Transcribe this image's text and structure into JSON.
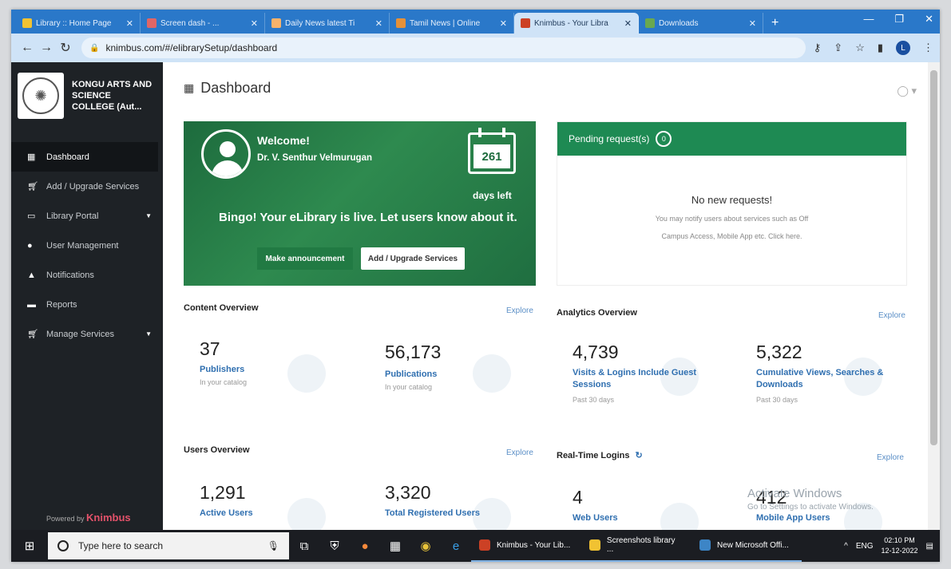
{
  "browser": {
    "tabs": [
      {
        "title": "Library :: Home Page",
        "favicon_color": "#f1c232"
      },
      {
        "title": "Screen dash - ... ",
        "favicon_color": "#e06666"
      },
      {
        "title": "Daily News latest Ti",
        "favicon_color": "#f6b26b"
      },
      {
        "title": "Tamil News | Online",
        "favicon_color": "#e69138"
      },
      {
        "title": "Knimbus - Your Libra",
        "favicon_color": "#cc4125"
      },
      {
        "title": "Downloads",
        "favicon_color": "#6aa84f"
      }
    ],
    "url": "knimbus.com/#/elibrarySetup/dashboard"
  },
  "sidebar": {
    "college_name": "KONGU ARTS AND SCIENCE COLLEGE (Aut...",
    "items": [
      {
        "label": "Dashboard",
        "icon": "grid-icon"
      },
      {
        "label": "Add / Upgrade Services",
        "icon": "cart-icon"
      },
      {
        "label": "Library Portal",
        "icon": "monitor-icon"
      },
      {
        "label": "User Management",
        "icon": "user-icon"
      },
      {
        "label": "Notifications",
        "icon": "bell-icon"
      },
      {
        "label": "Reports",
        "icon": "folder-icon"
      },
      {
        "label": "Manage Services",
        "icon": "cart-icon"
      }
    ],
    "powered_by": "Powered by",
    "brand": "Knimbus"
  },
  "main": {
    "title": "Dashboard",
    "welcome": {
      "greeting": "Welcome!",
      "name": "Dr. V. Senthur Velmurugan",
      "days": "261",
      "days_label": "days left",
      "message": "Bingo! Your eLibrary is live. Let users know about it.",
      "announce_btn": "Make announcement",
      "upgrade_btn": "Add / Upgrade Services"
    },
    "pending": {
      "title": "Pending request(s)",
      "count": "0",
      "empty": "No new requests!",
      "hint1": "You may notify users about services such as Off",
      "hint2": "Campus Access, Mobile App etc. Click here."
    },
    "content_overview": {
      "title": "Content Overview",
      "explore": "Explore",
      "cards": [
        {
          "value": "37",
          "label": "Publishers",
          "sub": "In your catalog"
        },
        {
          "value": "56,173",
          "label": "Publications",
          "sub": "In your catalog"
        }
      ]
    },
    "analytics_overview": {
      "title": "Analytics Overview",
      "explore": "Explore",
      "cards": [
        {
          "value": "4,739",
          "label": "Visits & Logins Include Guest Sessions",
          "sub": "Past 30 days"
        },
        {
          "value": "5,322",
          "label": "Cumulative Views, Searches & Downloads",
          "sub": "Past 30 days"
        }
      ]
    },
    "users_overview": {
      "title": "Users Overview",
      "explore": "Explore",
      "cards": [
        {
          "value": "1,291",
          "label": "Active Users"
        },
        {
          "value": "3,320",
          "label": "Total Registered Users"
        }
      ]
    },
    "realtime": {
      "title": "Real-Time Logins",
      "explore": "Explore",
      "cards": [
        {
          "value": "4",
          "label": "Web Users"
        },
        {
          "value": "412",
          "label": "Mobile App Users"
        }
      ]
    },
    "windows_watermark": "Activate Windows",
    "windows_watermark_sub": "Go to Settings to activate Windows."
  },
  "taskbar": {
    "search_placeholder": "Type here to search",
    "apps": [
      {
        "label": "Knimbus - Your Lib...",
        "color": "#cc4125"
      },
      {
        "label": "Screenshots library ...",
        "color": "#f1c232"
      },
      {
        "label": "New Microsoft Offi...",
        "color": "#3d85c6"
      }
    ],
    "lang": "ENG",
    "time": "02:10 PM",
    "date": "12-12-2022"
  }
}
